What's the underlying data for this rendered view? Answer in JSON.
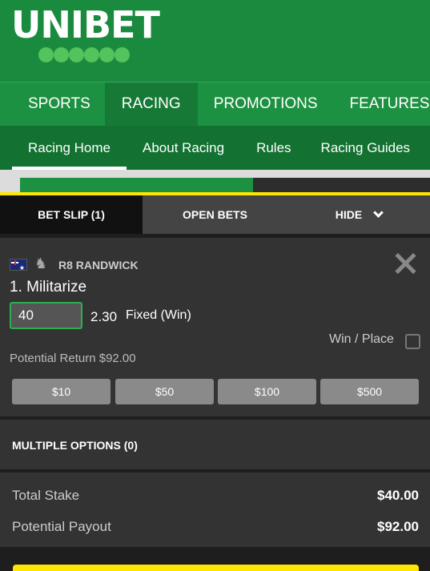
{
  "brand": {
    "name": "UNIBET"
  },
  "main_nav": [
    "SPORTS",
    "RACING",
    "PROMOTIONS",
    "FEATURES"
  ],
  "sub_nav": [
    "Racing Home",
    "About Racing",
    "Rules",
    "Racing Guides"
  ],
  "bet_slip": {
    "tabs": {
      "bet_slip": "BET SLIP (1)",
      "open_bets": "OPEN BETS",
      "hide": "HIDE"
    },
    "bet": {
      "race": "R8 RANDWICK",
      "runner": "1. Militarize",
      "stake": "40",
      "odds": "2.30",
      "bet_type": "Fixed (Win)",
      "win_place_label": "Win / Place",
      "win_place_checked": false,
      "potential_return": "Potential Return $92.00",
      "quick_stakes": [
        "$10",
        "$50",
        "$100",
        "$500"
      ]
    },
    "multiple_options": "MULTIPLE OPTIONS (0)",
    "totals": {
      "total_stake_label": "Total Stake",
      "total_stake_value": "$40.00",
      "potential_payout_label": "Potential Payout",
      "potential_payout_value": "$92.00"
    }
  },
  "icons": {
    "close": "close-icon",
    "flag": "australia-flag-icon",
    "horse": "horse-racing-icon",
    "hide": "chevron-down-icon"
  },
  "colors": {
    "brand_green": "#1d9142",
    "accent_yellow": "#ffe600",
    "stake_border": "#2eae52"
  }
}
